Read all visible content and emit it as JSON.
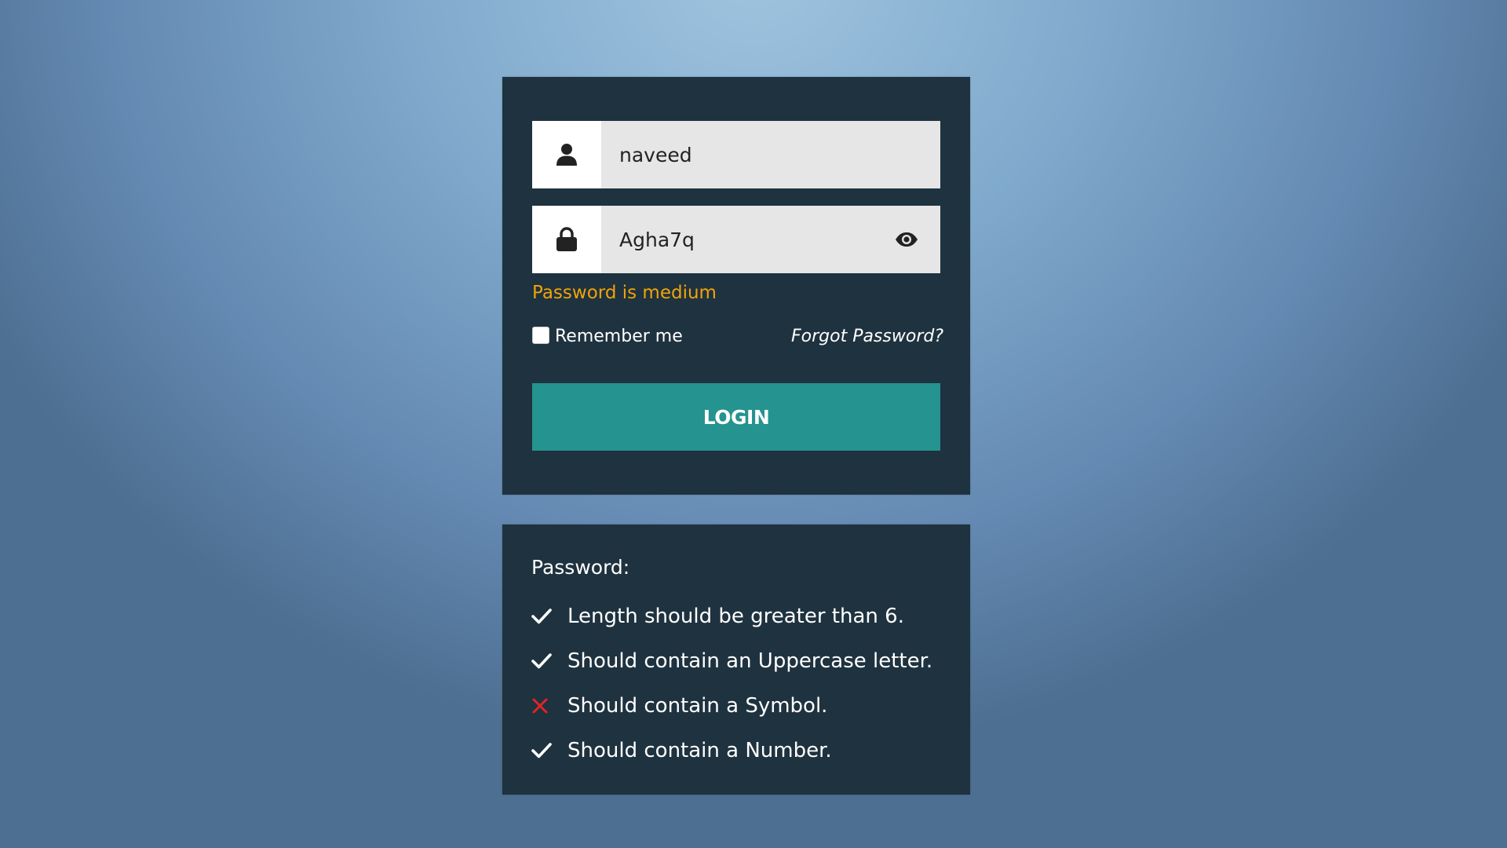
{
  "login": {
    "username": {
      "value": "naveed",
      "icon": "user-icon"
    },
    "password": {
      "value": "Agha7q",
      "icon": "lock-icon",
      "toggle_icon": "eye-icon"
    },
    "strength_message": "Password is medium",
    "strength_color": "#f0a30a",
    "remember_label": "Remember me",
    "remember_checked": false,
    "forgot_label": "Forgot Password?",
    "button_label": "LOGIN",
    "button_color": "#259390"
  },
  "rules": {
    "title": "Password:",
    "items": [
      {
        "text": "Length should be greater than 6.",
        "status": "pass",
        "icon": "check-icon"
      },
      {
        "text": "Should contain an Uppercase letter.",
        "status": "pass",
        "icon": "check-icon"
      },
      {
        "text": "Should contain a Symbol.",
        "status": "fail",
        "icon": "cross-icon"
      },
      {
        "text": "Should contain a Number.",
        "status": "pass",
        "icon": "check-icon"
      }
    ]
  },
  "colors": {
    "card_background": "#1f323f",
    "fail_mark": "#e02424",
    "pass_mark": "#ffffff"
  }
}
